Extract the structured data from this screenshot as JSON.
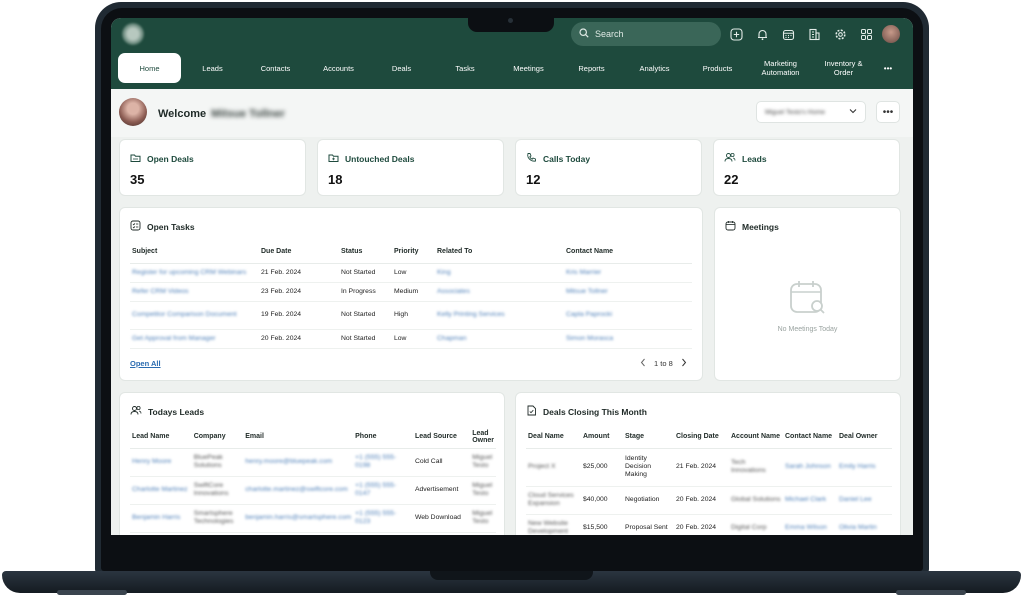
{
  "search": {
    "placeholder": "Search"
  },
  "nav": [
    {
      "label": "Home",
      "active": true
    },
    {
      "label": "Leads"
    },
    {
      "label": "Contacts"
    },
    {
      "label": "Accounts"
    },
    {
      "label": "Deals"
    },
    {
      "label": "Tasks"
    },
    {
      "label": "Meetings"
    },
    {
      "label": "Reports"
    },
    {
      "label": "Analytics"
    },
    {
      "label": "Products"
    },
    {
      "label": "Marketing Automation"
    },
    {
      "label": "Inventory & Order"
    },
    {
      "label": "•••"
    }
  ],
  "welcome": {
    "greeting": "Welcome",
    "name": "Mitsue Tollner",
    "selector": "Miguel Testo's Home",
    "more": "•••"
  },
  "stats": [
    {
      "label": "Open Deals",
      "value": "35",
      "icon": "folder-icon"
    },
    {
      "label": "Untouched Deals",
      "value": "18",
      "icon": "folder-plus-icon"
    },
    {
      "label": "Calls Today",
      "value": "12",
      "icon": "phone-icon"
    },
    {
      "label": "Leads",
      "value": "22",
      "icon": "users-icon"
    }
  ],
  "open_tasks": {
    "title": "Open Tasks",
    "columns": [
      "Subject",
      "Due Date",
      "Status",
      "Priority",
      "Related To",
      "Contact Name"
    ],
    "rows": [
      [
        "Register for upcoming CRM Webinars",
        "21 Feb. 2024",
        "Not Started",
        "Low",
        "King",
        "Kris Marrier"
      ],
      [
        "Refer CRM Videos",
        "23 Feb. 2024",
        "In Progress",
        "Medium",
        "Associates",
        "Mitsue Tollner"
      ],
      [
        "Competitor Comparison Document",
        "19 Feb. 2024",
        "Not Started",
        "High",
        "Kelly Printing Services",
        "Capla Paprocki"
      ],
      [
        "Get Approval from Manager",
        "20 Feb. 2024",
        "Not Started",
        "Low",
        "Chapman",
        "Simon Morasca"
      ]
    ],
    "open_all": "Open All",
    "pager": "1 to 8"
  },
  "meetings": {
    "title": "Meetings",
    "empty": "No Meetings Today"
  },
  "todays_leads": {
    "title": "Todays Leads",
    "columns": [
      "Lead Name",
      "Company",
      "Email",
      "Phone",
      "Lead Source",
      "Lead Owner"
    ],
    "rows": [
      [
        "Henry Moore",
        "BluePeak Solutions",
        "henry.moore@bluepeak.com",
        "+1 (555) 555-0198",
        "Cold Call",
        "Miguel Testo"
      ],
      [
        "Charlotte Martinez",
        "SwiftCore Innovations",
        "charlotte.martinez@swiftcore.com",
        "+1 (555) 555-0147",
        "Advertisement",
        "Miguel Testo"
      ],
      [
        "Benjamin Harris",
        "Smartsphere Technologies",
        "benjamin.harris@smartsphere.com",
        "+1 (555) 555-0123",
        "Web Download",
        "Miguel Testo"
      ]
    ]
  },
  "deals_closing": {
    "title": "Deals Closing This Month",
    "columns": [
      "Deal Name",
      "Amount",
      "Stage",
      "Closing Date",
      "Account Name",
      "Contact Name",
      "Deal Owner"
    ],
    "rows": [
      [
        "Project X",
        "$25,000",
        "Identity Decision Making",
        "21 Feb. 2024",
        "Tech Innovations",
        "Sarah Johnson",
        "Emily Harris"
      ],
      [
        "Cloud Services Expansion",
        "$40,000",
        "Negotiation",
        "20 Feb. 2024",
        "Global Solutions",
        "Michael Clark",
        "Daniel Lee"
      ],
      [
        "New Website Development",
        "$15,500",
        "Proposal Sent",
        "20 Feb. 2024",
        "Digital Corp",
        "Emma Wilson",
        "Olivia Martin"
      ]
    ]
  },
  "colors": {
    "brand": "#1e4a3d",
    "link": "#2a6bb0"
  }
}
